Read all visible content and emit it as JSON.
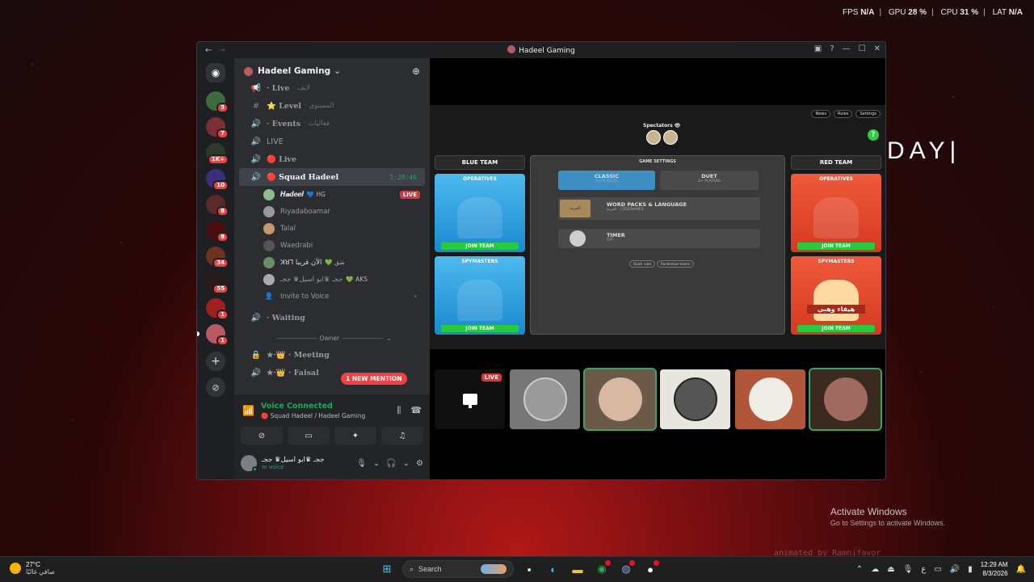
{
  "overlay": {
    "fps_label": "FPS",
    "fps_value": "N/A",
    "gpu_label": "GPU",
    "gpu_value": "28 %",
    "cpu_label": "CPU",
    "cpu_value": "31 %",
    "lat_label": "LAT",
    "lat_value": "N/A"
  },
  "wallpaper": {
    "text": "DAY|",
    "watermark": "animated by Ramnifavor"
  },
  "activate": {
    "title": "Activate Windows",
    "subtitle": "Go to Settings to activate Windows."
  },
  "window": {
    "title": "Hadeel Gaming"
  },
  "guild_badges": [
    "3",
    "7",
    "1K+",
    "10",
    "8",
    "8",
    "34",
    "55",
    "1",
    "1"
  ],
  "server": {
    "name": "Hadeel Gaming"
  },
  "channels": [
    {
      "icon": "megaphone-icon",
      "name": "· Live",
      "arabic": "· لايف"
    },
    {
      "icon": "hash-icon",
      "name": "⭐ Level",
      "arabic": "· المستوى"
    },
    {
      "icon": "speaker-icon",
      "name": "· Events",
      "arabic": "· فعاليات"
    },
    {
      "icon": "speaker-icon",
      "name": "LIVE"
    },
    {
      "icon": "speaker-icon",
      "name": "🔴 Live"
    },
    {
      "icon": "speaker-icon",
      "name": "🔴 Squad Hadeel",
      "timer": "1:28:46",
      "active": true
    }
  ],
  "members": [
    {
      "name": "𝑯𝒂𝒅𝒆𝒆𝒍",
      "tag": "💙 HG",
      "live": "LIVE",
      "color": "#8fbc8f"
    },
    {
      "name": "Riyadaboamar",
      "color": "#9a9a9a"
    },
    {
      "name": "Talal",
      "color": "#c49a6c"
    },
    {
      "name": "Waedrabi",
      "color": "#555"
    },
    {
      "name": "ꓘꓤꓶ الآن قريبا",
      "tag": "💚 شق",
      "color": "#6a8e6a"
    },
    {
      "name": "ججـ ♛ابو اسيل♛ ججـ",
      "tag": "💚 AKS",
      "color": "#aaa"
    }
  ],
  "invite_label": "Invite to Voice",
  "more_channels": [
    {
      "icon": "speaker-icon",
      "name": "· Waiting"
    }
  ],
  "owner_category": "Owner",
  "locked_channels": [
    {
      "icon": "lock-icon",
      "name": "★·👑 · Meeting"
    },
    {
      "icon": "speaker-icon",
      "name": "★·👑 · Faisal"
    }
  ],
  "mention_pill": "1 NEW MENTION",
  "voice": {
    "status": "Voice Connected",
    "channel": "🔴 Squad Hadeel / Hadeel Gaming"
  },
  "user": {
    "name": "ججـ ♛ابو اسيل♛ ججـ",
    "status": "In voice"
  },
  "game": {
    "top_buttons": [
      "News",
      "Rules",
      "Settings"
    ],
    "spectators_label": "Spectators 👁",
    "blue_team": "BLUE TEAM",
    "red_team": "RED TEAM",
    "operatives": "OPERATIVES",
    "spymasters": "SPYMASTERS",
    "join": "JOIN TEAM",
    "spymaster_caption": "هيفاء وهبي",
    "settings_title": "GAME SETTINGS",
    "classic": "CLASSIC",
    "classic_sub": "4+ PLAYERS",
    "duet": "DUET",
    "duet_sub": "2+ PLAYERS",
    "wordpacks": "WORD PACKS & LANGUAGE",
    "wordpacks_sub": "العربية · CODENAMES",
    "pack_tile": "العربية",
    "timer": "TIMER",
    "timer_sub": "OFF",
    "quick_rules": "Quick rules",
    "random_teams": "Randomize teams"
  },
  "tiles": {
    "live": "LIVE"
  },
  "taskbar": {
    "temp": "27°C",
    "weather": "صافي غالبًا",
    "search": "Search",
    "time": "12:29 AM",
    "date": "8/3/2026",
    "lang": "ع"
  }
}
